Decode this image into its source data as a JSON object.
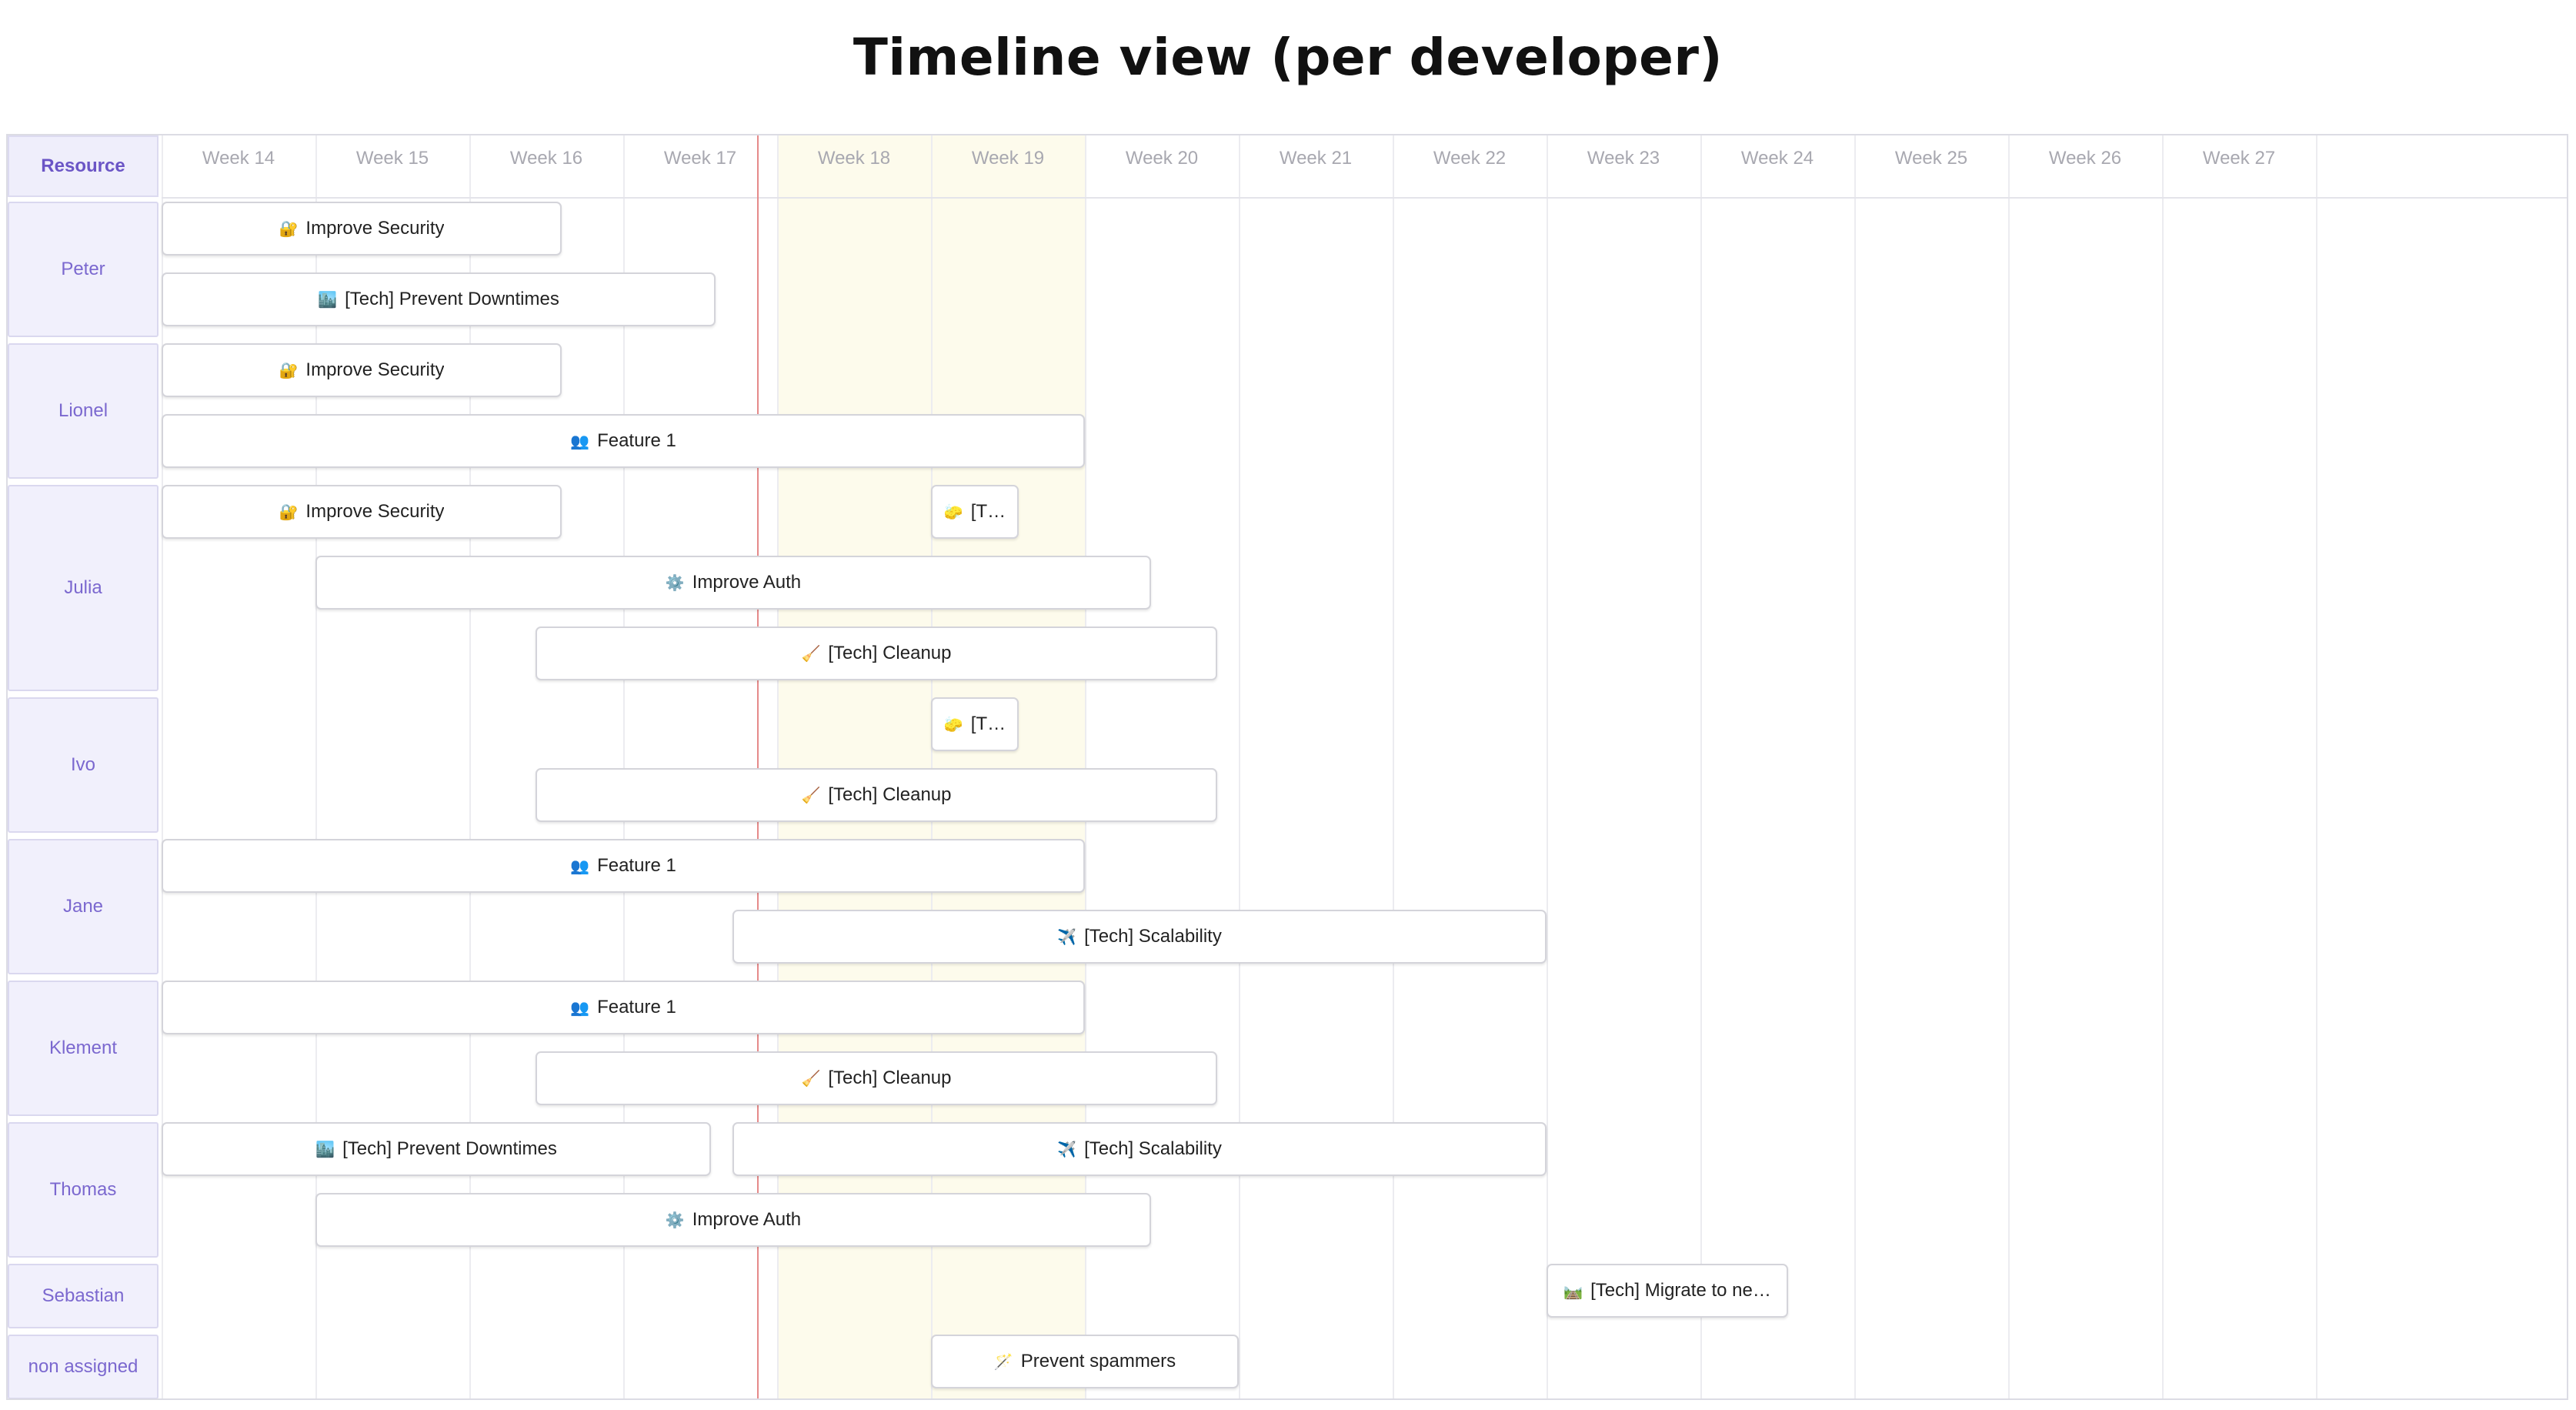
{
  "page": {
    "title": "Timeline view (per developer)"
  },
  "header": {
    "resource_label": "Resource"
  },
  "weeks": [
    "Week 14",
    "Week 15",
    "Week 16",
    "Week 17",
    "Week 18",
    "Week 19",
    "Week 20",
    "Week 21",
    "Week 22",
    "Week 23",
    "Week 24",
    "Week 25",
    "Week 26",
    "Week 27"
  ],
  "highlight_weeks": [
    "Week 18",
    "Week 19"
  ],
  "resources": [
    {
      "name": "Peter",
      "rows": [
        [
          {
            "label": "Improve Security",
            "icon": "🔐",
            "icon_name": "lock-with-key-icon",
            "start": 14,
            "end": 16.6
          }
        ],
        [
          {
            "label": "[Tech] Prevent Downtimes",
            "icon": "🏙️",
            "icon_name": "cityscape-icon",
            "start": 14,
            "end": 17.6
          }
        ]
      ]
    },
    {
      "name": "Lionel",
      "rows": [
        [
          {
            "label": "Improve Security",
            "icon": "🔐",
            "icon_name": "lock-with-key-icon",
            "start": 14,
            "end": 16.6
          }
        ],
        [
          {
            "label": "Feature 1",
            "icon": "👥",
            "icon_name": "people-icon",
            "start": 14,
            "end": 20
          }
        ]
      ]
    },
    {
      "name": "Julia",
      "rows": [
        [
          {
            "label": "Improve Security",
            "icon": "🔐",
            "icon_name": "lock-with-key-icon",
            "start": 14,
            "end": 16.6
          },
          {
            "label": "[T…",
            "icon": "🧽",
            "icon_name": "sponge-icon",
            "start": 19,
            "end": 19.57
          }
        ],
        [
          {
            "label": "Improve Auth",
            "icon": "⚙️",
            "icon_name": "gear-icon",
            "start": 15,
            "end": 20.43
          }
        ],
        [
          {
            "label": "[Tech] Cleanup",
            "icon": "🧹",
            "icon_name": "broom-icon",
            "start": 16.43,
            "end": 20.86
          }
        ]
      ]
    },
    {
      "name": "Ivo",
      "rows": [
        [
          {
            "label": "[T…",
            "icon": "🧽",
            "icon_name": "sponge-icon",
            "start": 19,
            "end": 19.57
          }
        ],
        [
          {
            "label": "[Tech] Cleanup",
            "icon": "🧹",
            "icon_name": "broom-icon",
            "start": 16.43,
            "end": 20.86
          }
        ]
      ]
    },
    {
      "name": "Jane",
      "rows": [
        [
          {
            "label": "Feature 1",
            "icon": "👥",
            "icon_name": "people-icon",
            "start": 14,
            "end": 20
          }
        ],
        [
          {
            "label": "[Tech] Scalability",
            "icon": "✈️",
            "icon_name": "airplane-icon",
            "start": 17.71,
            "end": 23
          }
        ]
      ]
    },
    {
      "name": "Klement",
      "rows": [
        [
          {
            "label": "Feature 1",
            "icon": "👥",
            "icon_name": "people-icon",
            "start": 14,
            "end": 20
          }
        ],
        [
          {
            "label": "[Tech] Cleanup",
            "icon": "🧹",
            "icon_name": "broom-icon",
            "start": 16.43,
            "end": 20.86
          }
        ]
      ]
    },
    {
      "name": "Thomas",
      "rows": [
        [
          {
            "label": "[Tech] Prevent Downtimes",
            "icon": "🏙️",
            "icon_name": "cityscape-icon",
            "start": 14,
            "end": 17.57
          },
          {
            "label": "[Tech] Scalability",
            "icon": "✈️",
            "icon_name": "airplane-icon",
            "start": 17.71,
            "end": 23
          }
        ],
        [
          {
            "label": "Improve Auth",
            "icon": "⚙️",
            "icon_name": "gear-icon",
            "start": 15,
            "end": 20.43
          }
        ]
      ]
    },
    {
      "name": "Sebastian",
      "rows": [
        [
          {
            "label": "[Tech] Migrate to ne…",
            "icon": "🛤️",
            "icon_name": "railway-track-icon",
            "start": 23,
            "end": 24.57
          }
        ]
      ]
    },
    {
      "name": "non assigned",
      "rows": [
        [
          {
            "label": "Prevent spammers",
            "icon": "🪄",
            "icon_name": "magic-wand-icon",
            "start": 19,
            "end": 21
          }
        ]
      ]
    }
  ]
}
